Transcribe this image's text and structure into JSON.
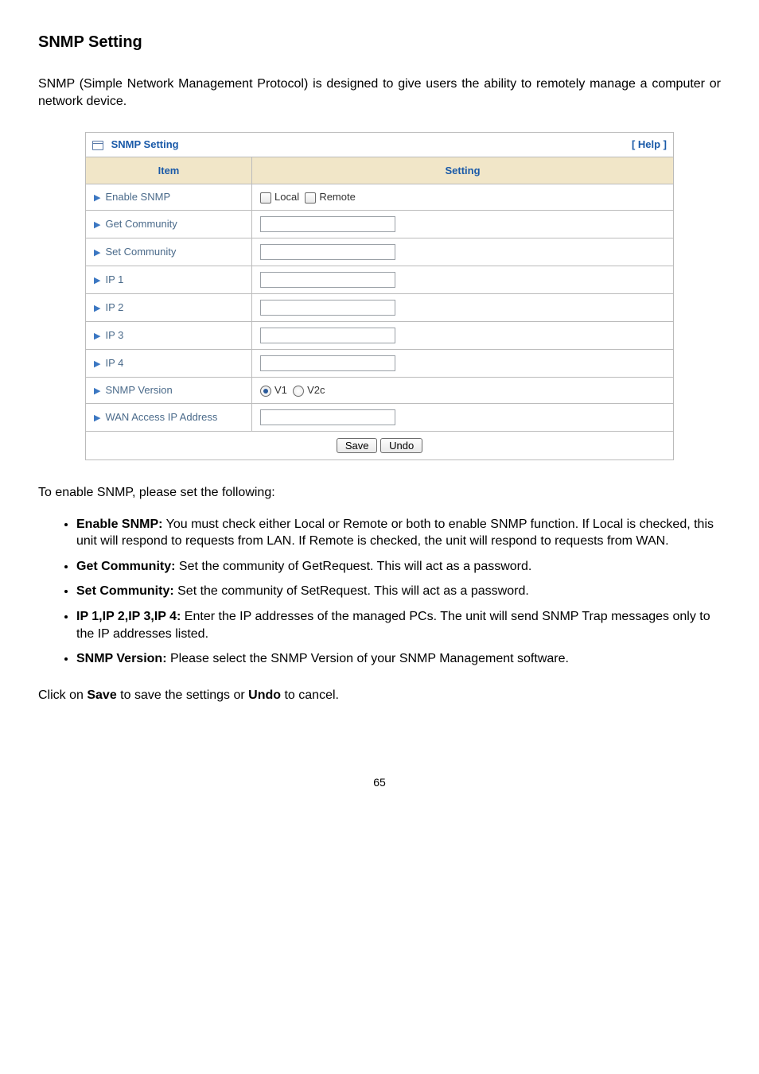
{
  "heading": "SNMP Setting",
  "intro": "SNMP (Simple Network Management Protocol) is designed to give users the ability to remotely manage a computer or network device.",
  "panel": {
    "title": "SNMP Setting",
    "help": "[ Help ]",
    "col_item": "Item",
    "col_setting": "Setting"
  },
  "rows": {
    "enable_snmp": {
      "label": "Enable SNMP",
      "local": "Local",
      "remote": "Remote"
    },
    "get_community": {
      "label": "Get Community",
      "value": ""
    },
    "set_community": {
      "label": "Set Community",
      "value": ""
    },
    "ip1": {
      "label": "IP 1",
      "value": ""
    },
    "ip2": {
      "label": "IP 2",
      "value": ""
    },
    "ip3": {
      "label": "IP 3",
      "value": ""
    },
    "ip4": {
      "label": "IP 4",
      "value": ""
    },
    "snmp_version": {
      "label": "SNMP Version",
      "v1": "V1",
      "v2c": "V2c"
    },
    "wan_access": {
      "label": "WAN Access IP Address",
      "value": ""
    }
  },
  "buttons": {
    "save": "Save",
    "undo": "Undo"
  },
  "lead2": "To enable SNMP, please set the following:",
  "bullets": {
    "b1": {
      "strong": "Enable SNMP:",
      "text": " You must check either Local or Remote or both to enable SNMP function. If Local is checked, this unit will respond to requests from LAN. If Remote is checked, the unit will respond to requests from WAN."
    },
    "b2": {
      "strong": "Get Community:",
      "text": " Set the community of GetRequest. This will act as a password."
    },
    "b3": {
      "strong": "Set Community:",
      "text": " Set the community of SetRequest. This will act as a password."
    },
    "b4": {
      "strong": "IP 1,IP 2,IP 3,IP 4:",
      "text": " Enter the IP addresses of the managed PCs. The unit will send SNMP Trap messages only to the IP addresses listed."
    },
    "b5": {
      "strong": "SNMP Version:",
      "text": " Please select the SNMP Version of your SNMP Management software."
    }
  },
  "closing": {
    "pre": "Click on ",
    "save": "Save",
    "mid": " to save the settings or ",
    "undo": "Undo",
    "post": " to cancel."
  },
  "page_number": "65"
}
